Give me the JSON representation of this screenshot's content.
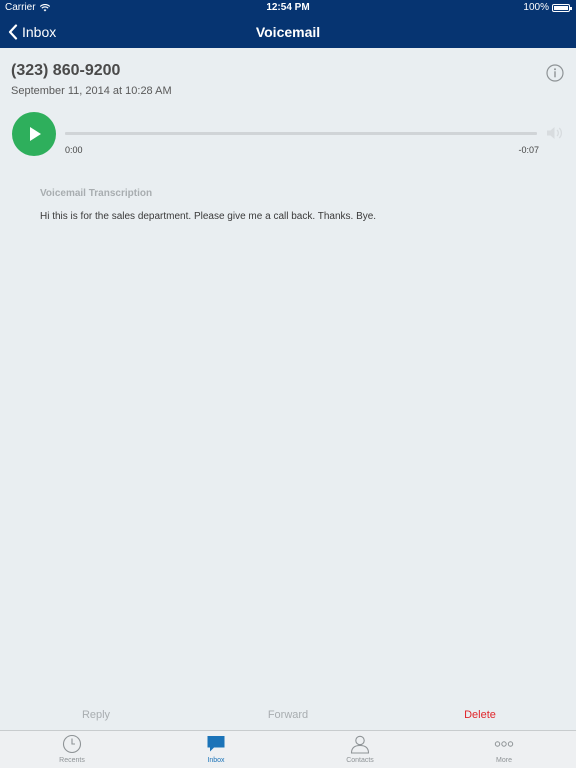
{
  "status_bar": {
    "carrier": "Carrier",
    "time": "12:54 PM",
    "battery": "100%"
  },
  "nav": {
    "back_label": "Inbox",
    "title": "Voicemail"
  },
  "voicemail": {
    "phone_number": "(323) 860-9200",
    "date": "September 11, 2014 at 10:28 AM"
  },
  "player": {
    "elapsed": "0:00",
    "remaining": "-0:07",
    "progress": 0
  },
  "transcription": {
    "label": "Voicemail Transcription",
    "text": "Hi this is for the sales department. Please give me a call back. Thanks. Bye."
  },
  "actions": {
    "reply": "Reply",
    "forward": "Forward",
    "delete": "Delete"
  },
  "tabs": [
    {
      "label": "Recents",
      "icon": "clock-icon",
      "active": false
    },
    {
      "label": "Inbox",
      "icon": "chat-bubble-icon",
      "active": true
    },
    {
      "label": "Contacts",
      "icon": "person-icon",
      "active": false
    },
    {
      "label": "More",
      "icon": "more-dots-icon",
      "active": false
    }
  ],
  "colors": {
    "header": "#063471",
    "play": "#2eaf5c",
    "delete": "#e0262b",
    "active_tab": "#1b73b8"
  }
}
